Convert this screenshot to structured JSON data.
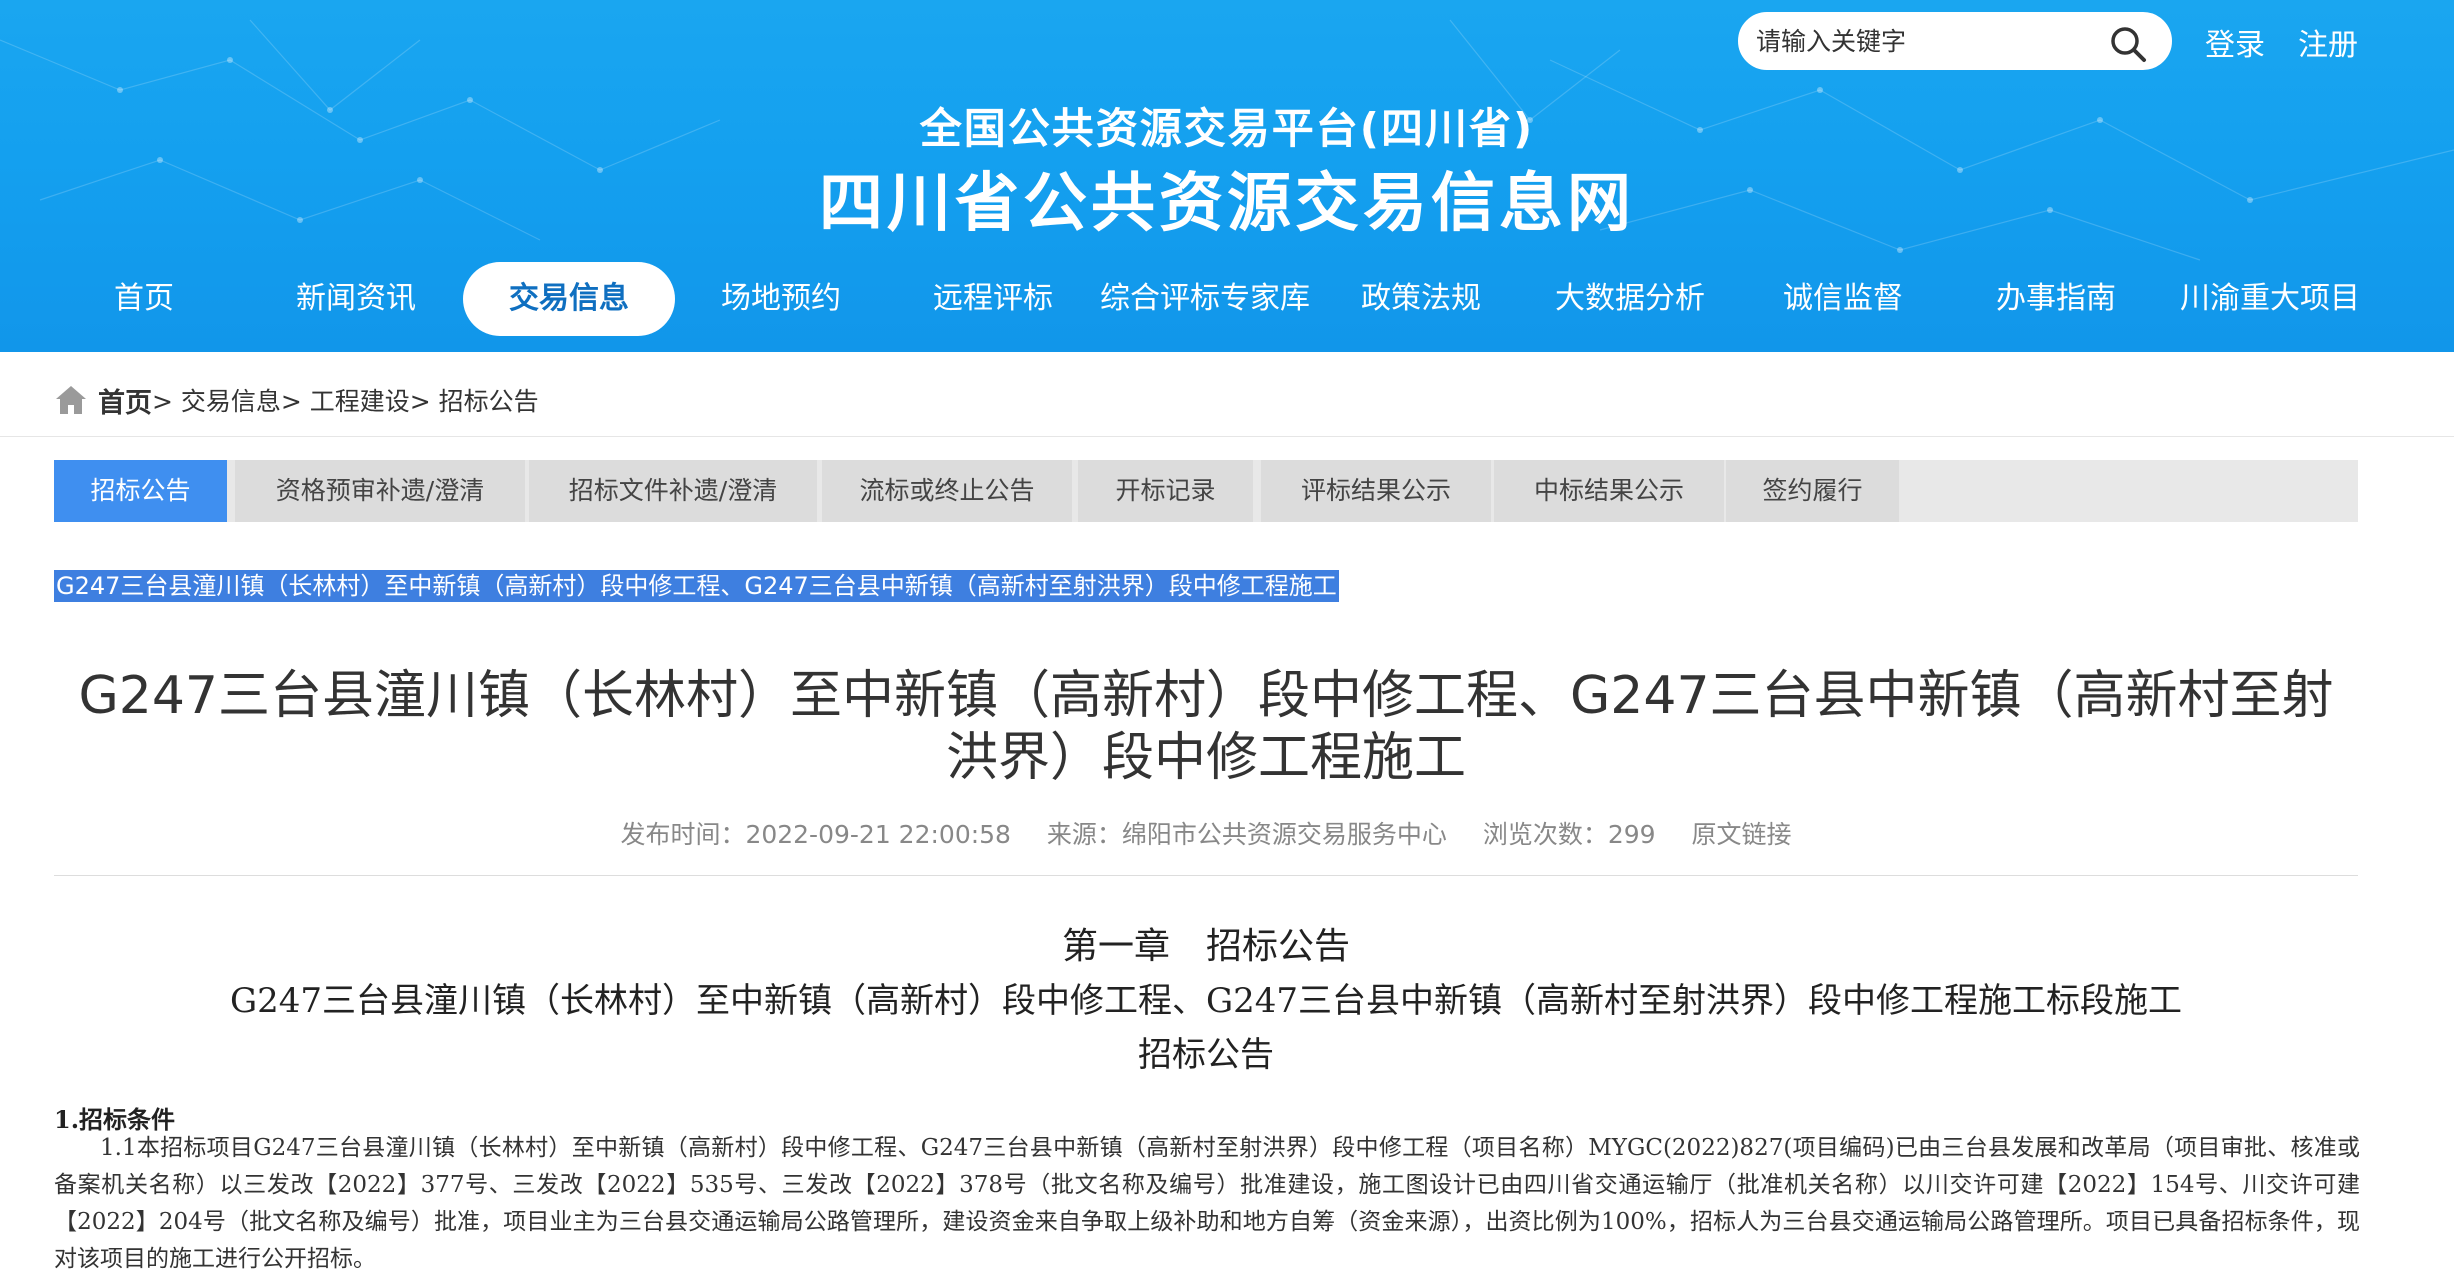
{
  "header": {
    "search_placeholder": "请输入关键字",
    "login": "登录",
    "register": "注册",
    "title_line1": "全国公共资源交易平台(四川省)",
    "title_line2": "四川省公共资源交易信息网"
  },
  "nav": {
    "items": [
      {
        "label": "首页"
      },
      {
        "label": "新闻资讯"
      },
      {
        "label": "交易信息"
      },
      {
        "label": "场地预约"
      },
      {
        "label": "远程评标"
      },
      {
        "label": "综合评标专家库"
      },
      {
        "label": "政策法规"
      },
      {
        "label": "大数据分析"
      },
      {
        "label": "诚信监督"
      },
      {
        "label": "办事指南"
      },
      {
        "label": "川渝重大项目"
      }
    ],
    "active": "交易信息"
  },
  "breadcrumb": {
    "home": "首页",
    "rest": "> 交易信息> 工程建设> 招标公告"
  },
  "tabs": [
    {
      "label": "招标公告"
    },
    {
      "label": "资格预审补遗/澄清"
    },
    {
      "label": "招标文件补遗/澄清"
    },
    {
      "label": "流标或终止公告"
    },
    {
      "label": "开标记录"
    },
    {
      "label": "评标结果公示"
    },
    {
      "label": "中标结果公示"
    },
    {
      "label": "签约履行"
    }
  ],
  "article": {
    "highlight_title": "G247三台县潼川镇（长林村）至中新镇（高新村）段中修工程、G247三台县中新镇（高新村至射洪界）段中修工程施工",
    "title": "G247三台县潼川镇（长林村）至中新镇（高新村）段中修工程、G247三台县中新镇（高新村至射洪界）段中修工程施工",
    "publish_time": "发布时间：2022-09-21 22:00:58",
    "source": "来源：绵阳市公共资源交易服务中心",
    "views": "浏览次数：299",
    "original_link": "原文链接",
    "chapter": "第一章　招标公告",
    "subtitle": "G247三台县潼川镇（长林村）至中新镇（高新村）段中修工程、G247三台县中新镇（高新村至射洪界）段中修工程施工标段施工",
    "subtitle2": "招标公告",
    "section1_head": "1.招标条件",
    "section1_body": "1.1本招标项目G247三台县潼川镇（长林村）至中新镇（高新村）段中修工程、G247三台县中新镇（高新村至射洪界）段中修工程（项目名称）MYGC(2022)827(项目编码)已由三台县发展和改革局（项目审批、核准或备案机关名称）以三发改【2022】377号、三发改【2022】535号、三发改【2022】378号（批文名称及编号）批准建设，施工图设计已由四川省交通运输厅（批准机关名称）以川交许可建【2022】154号、川交许可建【2022】204号（批文名称及编号）批准，项目业主为三台县交通运输局公路管理所，建设资金来自争取上级补助和地方自筹（资金来源），出资比例为100%，招标人为三台县交通运输局公路管理所。项目已具备招标条件，现对该项目的施工进行公开招标。"
  },
  "colors": {
    "header_bg": "#14a0ef",
    "active_tab": "#3f8ff0",
    "highlight": "#3e7fe0"
  }
}
